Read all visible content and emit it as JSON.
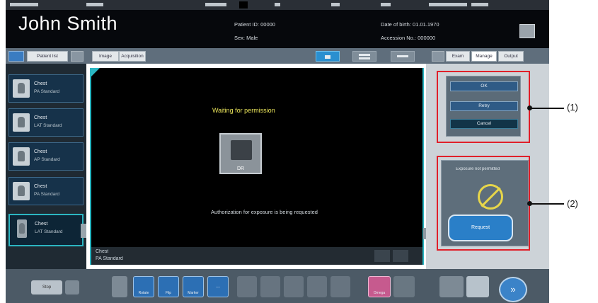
{
  "patient": {
    "name": "John Smith",
    "field_1": "Patient ID: 00000",
    "field_2": "Sex: Male",
    "field_3": "Date of birth: 01.01.1970",
    "field_4": "Accession No.: 000000"
  },
  "header": {
    "tab_patient": "Patient list",
    "tab_image": "Image",
    "tab_acq": "Acquisition"
  },
  "right_tabs": {
    "tab_a": "Exam",
    "tab_b": "Manage",
    "tab_c": "Output"
  },
  "thumbnails": [
    {
      "t1": "Chest",
      "t2": "PA Standard"
    },
    {
      "t1": "Chest",
      "t2": "LAT Standard"
    },
    {
      "t1": "Chest",
      "t2": "AP Standard"
    },
    {
      "t1": "Chest",
      "t2": "PA Standard"
    },
    {
      "t1": "Chest",
      "t2": "LAT Standard"
    }
  ],
  "viewer": {
    "waiting_text": "Waiting for permission",
    "tube_label": "DR",
    "status_msg": "Authorization for exposure is being requested",
    "foot_line1": "Chest",
    "foot_line2": "PA Standard"
  },
  "panel1": {
    "btn1": "OK",
    "btn2": "Retry",
    "btn3": "Cancel"
  },
  "panel2": {
    "title": "Exposure not permitted",
    "expose_btn": "Request"
  },
  "annotations": {
    "callout_1": "(1)",
    "callout_2": "(2)"
  },
  "bottom": {
    "left_label": "Stop",
    "tool_1": "Rotate",
    "tool_2": "Flip",
    "tool_3": "Marker",
    "tool_4": "...",
    "tool_5": "Omega",
    "next": "»"
  },
  "colors": {
    "accent": "#2bb6c2",
    "annotation_red": "#e0202a",
    "waiting_yellow": "#e9e35a",
    "button_blue": "#2a7fc8"
  }
}
